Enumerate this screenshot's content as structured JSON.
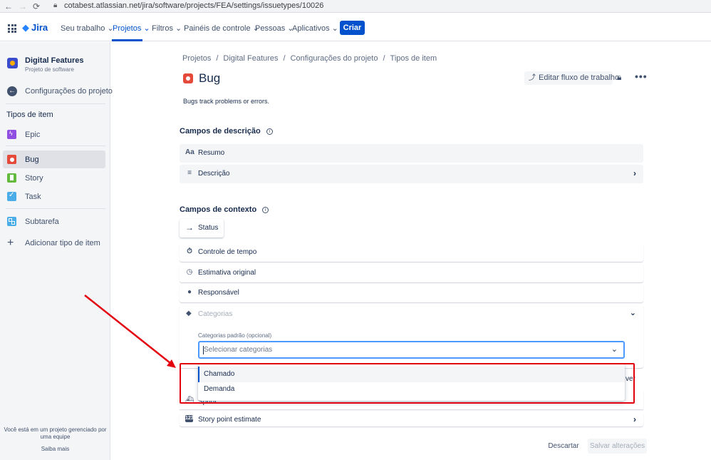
{
  "browser": {
    "back": "←",
    "forward": "→",
    "reload": "⟳",
    "url": "cotabest.atlassian.net/jira/software/projects/FEA/settings/issuetypes/10026"
  },
  "topnav": {
    "logo": "Jira",
    "items": [
      "Seu trabalho ⌄",
      "Projetos ⌄",
      "Filtros ⌄",
      "Painéis de controle ⌄",
      "Pessoas ⌄",
      "Aplicativos ⌄"
    ],
    "create": "Criar"
  },
  "sidebar": {
    "project_name": "Digital Features",
    "project_type": "Projeto de software",
    "back_label": "Configurações do projeto",
    "section": "Tipos de item",
    "types": [
      "Epic",
      "Bug",
      "Story",
      "Task"
    ],
    "subtask": "Subtarefa",
    "add_type": "Adicionar tipo de item",
    "footer_line1": "Você está em um projeto gerenciado por",
    "footer_line2": "uma equipe",
    "learn_more": "Saiba mais"
  },
  "breadcrumb": [
    "Projetos",
    "Digital Features",
    "Configurações do projeto",
    "Tipos de item"
  ],
  "page": {
    "title": "Bug",
    "description": "Bugs track problems or errors.",
    "edit_workflow": "Editar fluxo de trabalho"
  },
  "description_fields": {
    "title": "Campos de descrição",
    "rows": [
      {
        "icon": "Aa",
        "label": "Resumo"
      },
      {
        "icon": "≡",
        "label": "Descrição"
      }
    ]
  },
  "context_fields": {
    "title": "Campos de contexto",
    "status": "Status",
    "rows": [
      {
        "icon": "⏱",
        "label": "Controle de tempo"
      },
      {
        "icon": "◷",
        "label": "Estimativa original"
      },
      {
        "icon": "●",
        "label": "Responsável"
      }
    ],
    "categories": {
      "label": "Categorias",
      "default_label": "Categorias padrão (opcional)",
      "placeholder": "Selecionar categorias",
      "options": [
        "Chamado",
        "Demanda"
      ]
    },
    "peek_text": "ver",
    "sprint": "Sprint",
    "story_points": "Story point estimate"
  },
  "footer": {
    "discard": "Descartar",
    "save": "Salvar alterações"
  },
  "colors": {
    "accent": "#0052cc",
    "highlight": "#e3000f",
    "bug": "#e5493a",
    "epic": "#904ee2",
    "story": "#63ba3c",
    "task": "#4bade8"
  }
}
